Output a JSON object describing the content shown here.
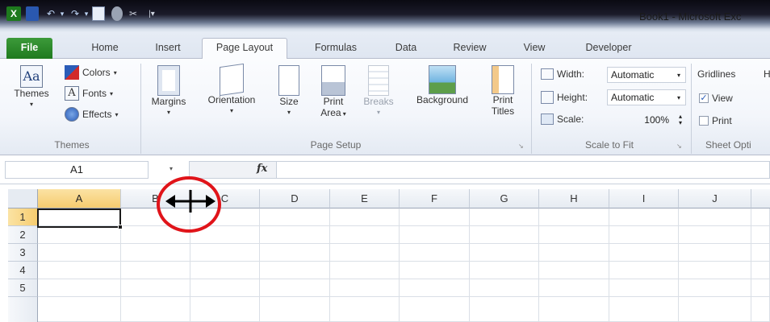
{
  "window": {
    "title": "Book1  -  Microsoft Exc"
  },
  "tabs": [
    "File",
    "Home",
    "Insert",
    "Page Layout",
    "Formulas",
    "Data",
    "Review",
    "View",
    "Developer"
  ],
  "active_tab": "Page Layout",
  "ribbon": {
    "themes": {
      "themes_label": "Themes",
      "colors": "Colors",
      "fonts": "Fonts",
      "effects": "Effects",
      "group_label": "Themes"
    },
    "page_setup": {
      "margins": "Margins",
      "orientation": "Orientation",
      "size": "Size",
      "print_area_1": "Print",
      "print_area_2": "Area",
      "breaks": "Breaks",
      "background": "Background",
      "print_titles_1": "Print",
      "print_titles_2": "Titles",
      "group_label": "Page Setup"
    },
    "scale_to_fit": {
      "width_label": "Width:",
      "width_value": "Automatic",
      "height_label": "Height:",
      "height_value": "Automatic",
      "scale_label": "Scale:",
      "scale_value": "100%",
      "group_label": "Scale to Fit"
    },
    "sheet_options": {
      "gridlines": "Gridlines",
      "view": "View",
      "print": "Print",
      "group_label": "Sheet Opti",
      "headings_partial": "H"
    }
  },
  "formula_bar": {
    "name_box": "A1",
    "fx": "fx",
    "formula": ""
  },
  "grid": {
    "columns": [
      "A",
      "B",
      "C",
      "D",
      "E",
      "F",
      "G",
      "H",
      "I",
      "J"
    ],
    "rows": [
      "1",
      "2",
      "3",
      "4",
      "5"
    ],
    "active_cell": "A1"
  },
  "cursor": {
    "name": "column-resize-cursor"
  },
  "colors": {
    "file_tab": "#2b8a2a",
    "annotation": "#e0141a",
    "active_header": "#f6cc6f"
  }
}
